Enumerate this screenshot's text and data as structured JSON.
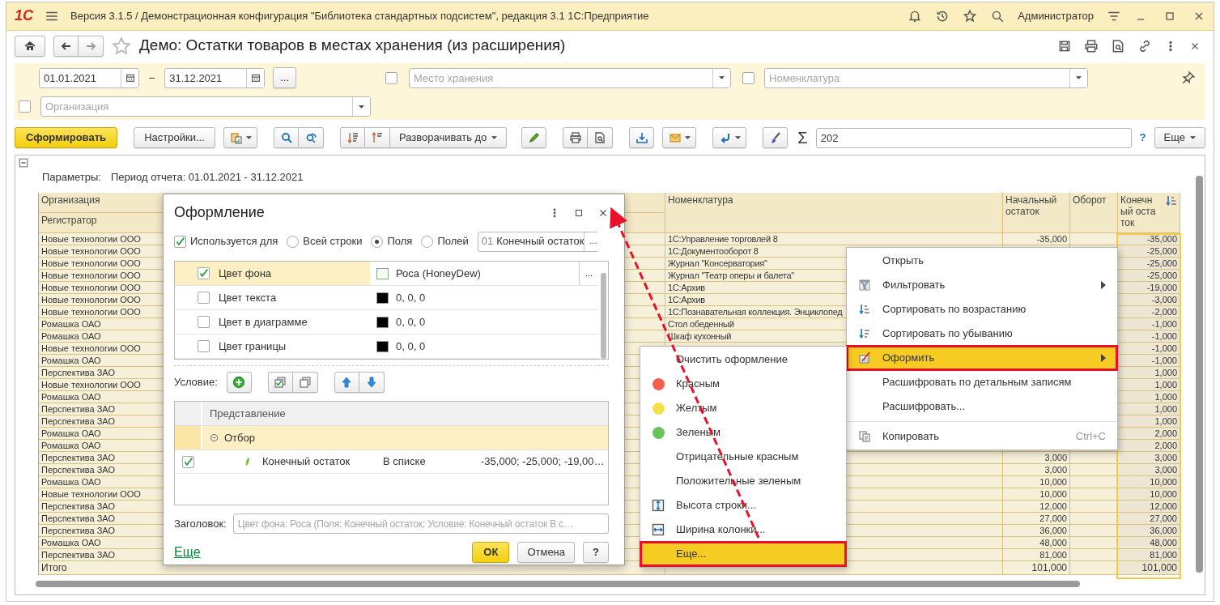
{
  "app_bar": {
    "logo": "1С",
    "title": "Версия 3.1.5 / Демонстрационная конфигурация \"Библиотека стандартных подсистем\", редакция 3.1 1С:Предприятие",
    "user": "Администратор"
  },
  "form": {
    "title": "Демо: Остатки товаров в местах хранения (из расширения)",
    "favorite": false
  },
  "filters": {
    "date_from": "01.01.2021",
    "dash": "–",
    "date_to": "31.12.2021",
    "period_button": "...",
    "storage": {
      "placeholder": "Место хранения",
      "checked": false
    },
    "nomenclature": {
      "placeholder": "Номенклатура",
      "checked": false
    },
    "organization": {
      "placeholder": "Организация",
      "checked": false
    }
  },
  "command_bar": {
    "generate": "Сформировать",
    "settings": "Настройки...",
    "expand": "Разворачивать до",
    "sum_sign": "Σ",
    "sum_value": "202",
    "help": "?",
    "more": "Еще"
  },
  "report": {
    "params_label": "Параметры:",
    "period": "Период отчета: 01.01.2021 - 31.12.2021",
    "header": {
      "organization": "Организация",
      "registrar": "Регистратор",
      "nomenclature": "Номенклатура",
      "start": "Начальный остаток",
      "turnover": "Оборот",
      "end": "Конечный остаток"
    },
    "rows": [
      {
        "organization": "Новые технологии ООО",
        "nomenclature": "1С:Управление торговлей 8",
        "start": "-35,000",
        "end": "-35,000"
      },
      {
        "organization": "Новые технологии ООО",
        "nomenclature": "1С:Документооборот 8",
        "end": "-25,000"
      },
      {
        "organization": "Новые технологии ООО",
        "nomenclature": "Журнал \"Консерватория\"",
        "end": "-25,000"
      },
      {
        "organization": "Новые технологии ООО",
        "nomenclature": "Журнал \"Театр оперы и балета\"",
        "end": "-25,000"
      },
      {
        "organization": "Новые технологии ООО",
        "nomenclature": "1С:Архив",
        "end": "-19,000"
      },
      {
        "organization": "Новые технологии ООО",
        "nomenclature": "1С:Архив",
        "end": "-3,000"
      },
      {
        "organization": "Новые технологии ООО",
        "nomenclature": "1С:Познавательная коллекция. Энциклопед",
        "end": "-2,000"
      },
      {
        "organization": "Ромашка ОАО",
        "nomenclature": "Стол обеденный",
        "end": "-1,000"
      },
      {
        "organization": "Ромашка ОАО",
        "nomenclature": "Шкаф кухонный",
        "end": "-1,000"
      },
      {
        "organization": "Новые технологии ООО",
        "end": "-1,000"
      },
      {
        "organization": "Ромашка ОАО",
        "end": "-1,000"
      },
      {
        "organization": "Перспектива ЗАО",
        "end": "1,000"
      },
      {
        "organization": "Новые технологии ООО",
        "end": "1,000"
      },
      {
        "organization": "Ромашка ОАО",
        "end": "1,000"
      },
      {
        "organization": "Перспектива ЗАО",
        "end": "1,000"
      },
      {
        "organization": "Перспектива ЗАО",
        "end": "1,000"
      },
      {
        "organization": "Ромашка ОАО",
        "end": "2,000"
      },
      {
        "organization": "Ромашка ОАО",
        "end": "2,000"
      },
      {
        "organization": "Перспектива ЗАО",
        "start": "3,000",
        "end": "3,000"
      },
      {
        "organization": "Перспектива ЗАО",
        "start": "3,000",
        "end": "3,000"
      },
      {
        "organization": "Ромашка ОАО",
        "start": "10,000",
        "end": "10,000"
      },
      {
        "organization": "Новые технологии ООО",
        "start": "10,000",
        "end": "10,000"
      },
      {
        "organization": "Перспектива ЗАО",
        "start": "12,000",
        "end": "12,000"
      },
      {
        "organization": "Перспектива ЗАО",
        "start": "27,000",
        "end": "27,000"
      },
      {
        "organization": "Перспектива ЗАО",
        "start": "36,000",
        "end": "36,000"
      },
      {
        "organization": "Ромашка ОАО",
        "start": "48,000",
        "end": "48,000"
      },
      {
        "organization": "Перспектива ЗАО",
        "start": "81,000",
        "end": "81,000"
      }
    ],
    "total": {
      "label": "Итого",
      "start": "101,000",
      "end": "101,000"
    }
  },
  "dialog": {
    "title": "Оформление",
    "used_for": {
      "label": "Используется для",
      "checked": true
    },
    "scope": [
      {
        "label": "Всей строки",
        "selected": false
      },
      {
        "label": "Поля",
        "selected": true
      },
      {
        "label": "Полей",
        "selected": false
      }
    ],
    "field": {
      "number": "01",
      "value": "Конечный остаток",
      "button": "..."
    },
    "appearance": [
      {
        "label": "Цвет фона",
        "checked": true,
        "selected": true,
        "value": "Роса (HoneyDew)",
        "color": "#f0fff0"
      },
      {
        "label": "Цвет текста",
        "checked": false,
        "selected": false,
        "value": "0, 0, 0",
        "color": "#000000"
      },
      {
        "label": "Цвет в диаграмме",
        "checked": false,
        "selected": false,
        "value": "0, 0, 0",
        "color": "#000000"
      },
      {
        "label": "Цвет границы",
        "checked": false,
        "selected": false,
        "value": "0, 0, 0",
        "color": "#000000"
      }
    ],
    "appearance_button": "...",
    "condition_label": "Условие:",
    "conditions": {
      "column": "Представление",
      "group": {
        "label": "Отбор",
        "expanded": true,
        "selected": true
      },
      "rows": [
        {
          "checked": true,
          "field": "Конечный остаток",
          "comparison": "В списке",
          "value": "-35,000; -25,000; -19,00…"
        }
      ]
    },
    "caption": {
      "label": "Заголовок:",
      "placeholder": "Цвет фона: Роса (Поля: Конечный остаток; Условие: Конечный остаток В с…"
    },
    "more_link": "Еще",
    "ok": "ОК",
    "cancel": "Отмена",
    "help": "?"
  },
  "context_menu": {
    "items": [
      {
        "kind": "plain",
        "label": "Открыть",
        "submenu": false,
        "selected": false,
        "annotated": false
      },
      {
        "kind": "filter",
        "label": "Фильтровать",
        "submenu": true,
        "selected": false,
        "annotated": false
      },
      {
        "kind": "sort-asc",
        "label": "Сортировать по возрастанию",
        "submenu": false,
        "selected": false,
        "annotated": false
      },
      {
        "kind": "sort-desc",
        "label": "Сортировать по убыванию",
        "submenu": false,
        "selected": false,
        "annotated": false
      },
      {
        "kind": "format",
        "label": "Оформить",
        "submenu": true,
        "selected": true,
        "annotated": true
      },
      {
        "kind": "plain",
        "label": "Расшифровать по детальным записям",
        "submenu": false,
        "selected": false,
        "annotated": false
      },
      {
        "kind": "plain",
        "label": "Расшифровать...",
        "submenu": false,
        "selected": false,
        "annotated": false
      },
      {
        "kind": "separator"
      },
      {
        "kind": "copy",
        "label": "Копировать",
        "shortcut": "Ctrl+C",
        "submenu": false,
        "selected": false,
        "annotated": false
      }
    ]
  },
  "submenu": {
    "items": [
      {
        "kind": "plain",
        "label": "Очистить оформление",
        "selected": false,
        "annotated": false
      },
      {
        "kind": "color",
        "label": "Красным",
        "color": "#f0604a",
        "selected": false,
        "annotated": false
      },
      {
        "kind": "color",
        "label": "Желтым",
        "color": "#f3e14c",
        "selected": false,
        "annotated": false
      },
      {
        "kind": "color",
        "label": "Зеленым",
        "color": "#6ac45c",
        "selected": false,
        "annotated": false
      },
      {
        "kind": "plain",
        "label": "Отрицательные красным",
        "selected": false,
        "annotated": false
      },
      {
        "kind": "plain",
        "label": "Положительные зеленым",
        "selected": false,
        "annotated": false
      },
      {
        "kind": "height",
        "label": "Высота строки...",
        "selected": false,
        "annotated": false
      },
      {
        "kind": "width",
        "label": "Ширина колонки...",
        "selected": false,
        "annotated": false
      },
      {
        "kind": "plain",
        "label": "Еще...",
        "selected": true,
        "annotated": true
      }
    ]
  },
  "annotations": {
    "arrow": true
  }
}
